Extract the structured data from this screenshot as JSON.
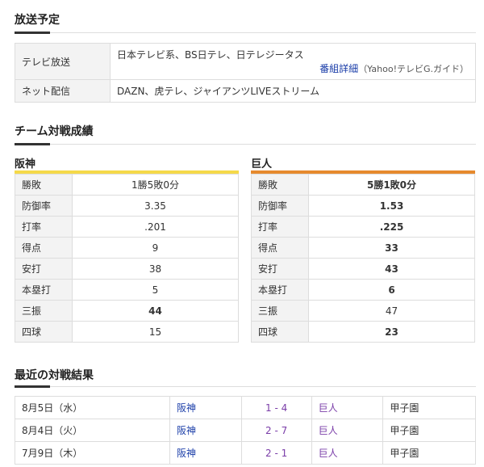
{
  "broadcast": {
    "title": "放送予定",
    "rows": [
      {
        "label": "テレビ放送",
        "value": "日本テレビ系、BS日テレ、日テレジータス",
        "detail_link": "番組詳細",
        "detail_note": "（Yahoo!テレビG.ガイド）"
      },
      {
        "label": "ネット配信",
        "value": "DAZN、虎テレ、ジャイアンツLIVEストリーム"
      }
    ]
  },
  "record": {
    "title": "チーム対戦成績",
    "teams": [
      {
        "name": "阪神",
        "color": "#f5d949",
        "stats": [
          {
            "label": "勝敗",
            "value": "1勝5敗0分",
            "bold": false
          },
          {
            "label": "防御率",
            "value": "3.35",
            "bold": false
          },
          {
            "label": "打率",
            "value": ".201",
            "bold": false
          },
          {
            "label": "得点",
            "value": "9",
            "bold": false
          },
          {
            "label": "安打",
            "value": "38",
            "bold": false
          },
          {
            "label": "本塁打",
            "value": "5",
            "bold": false
          },
          {
            "label": "三振",
            "value": "44",
            "bold": true
          },
          {
            "label": "四球",
            "value": "15",
            "bold": false
          }
        ]
      },
      {
        "name": "巨人",
        "color": "#e68a2e",
        "stats": [
          {
            "label": "勝敗",
            "value": "5勝1敗0分",
            "bold": true
          },
          {
            "label": "防御率",
            "value": "1.53",
            "bold": true
          },
          {
            "label": "打率",
            "value": ".225",
            "bold": true
          },
          {
            "label": "得点",
            "value": "33",
            "bold": true
          },
          {
            "label": "安打",
            "value": "43",
            "bold": true
          },
          {
            "label": "本塁打",
            "value": "6",
            "bold": true
          },
          {
            "label": "三振",
            "value": "47",
            "bold": false
          },
          {
            "label": "四球",
            "value": "23",
            "bold": true
          }
        ]
      }
    ]
  },
  "results": {
    "title": "最近の対戦結果",
    "rows": [
      {
        "date": "8月5日（水）",
        "home": "阪神",
        "score": "1 - 4",
        "away": "巨人",
        "venue": "甲子園"
      },
      {
        "date": "8月4日（火）",
        "home": "阪神",
        "score": "2 - 7",
        "away": "巨人",
        "venue": "甲子園"
      },
      {
        "date": "7月9日（木）",
        "home": "阪神",
        "score": "2 - 1",
        "away": "巨人",
        "venue": "甲子園"
      }
    ]
  }
}
